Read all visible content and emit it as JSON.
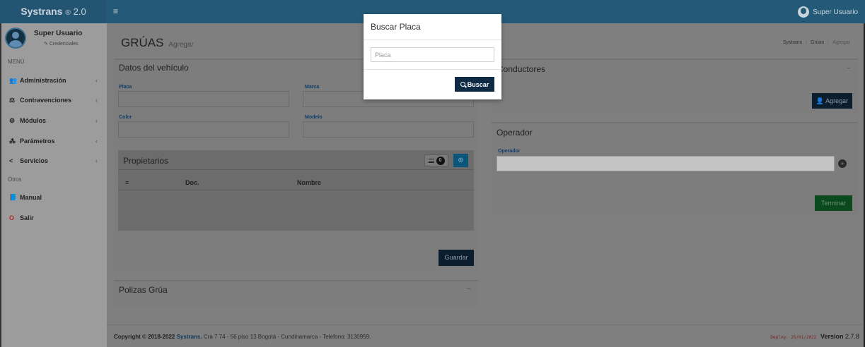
{
  "header": {
    "brand_name": "Systrans",
    "brand_reg": "®",
    "brand_version": "2.0",
    "menu_toggle": "≡",
    "user_name": "Super Usuario"
  },
  "sidebar": {
    "user_name": "Super Usuario",
    "credentials_label": "Credenciales",
    "menu_header": "MENÚ",
    "items": [
      {
        "label": "Administración",
        "icon": "users-icon",
        "glyph": "👥"
      },
      {
        "label": "Contravenciones",
        "icon": "balance-scale-icon",
        "glyph": "⚖"
      },
      {
        "label": "Módulos",
        "icon": "modules-icon",
        "glyph": "⚙"
      },
      {
        "label": "Parámetros",
        "icon": "sitemap-icon",
        "glyph": "⁂"
      },
      {
        "label": "Servicios",
        "icon": "share-icon",
        "glyph": "<"
      }
    ],
    "other_header": "Otros",
    "others": [
      {
        "label": "Manual",
        "icon": "book-icon",
        "glyph": "📘"
      },
      {
        "label": "Salir",
        "icon": "power-icon",
        "glyph": "O"
      }
    ]
  },
  "page": {
    "title": "GRÚAS",
    "subtitle": "Agregar",
    "breadcrumb": [
      "Systrans",
      "Grúas",
      "Agregar"
    ]
  },
  "vehicle": {
    "title": "Datos del vehículo",
    "placa_label": "Placa",
    "marca_label": "Marca",
    "color_label": "Color",
    "modelo_label": "Modelo",
    "placa_value": "",
    "marca_value": "",
    "color_value": "",
    "modelo_value": "",
    "propietarios_title": "Propietarios",
    "propietarios_count": "0",
    "table_headers": [
      "≡",
      "Doc.",
      "Nombre"
    ],
    "save_label": "Guardar"
  },
  "polizas": {
    "title": "Polizas Grúa",
    "collapse": "−"
  },
  "conductores": {
    "title": "Conductores",
    "collapse": "−",
    "add_label": "Agregar"
  },
  "operador": {
    "title": "Operador",
    "field_label": "Operador",
    "field_value": "",
    "finish_label": "Terminar"
  },
  "footer": {
    "copyright": "Copyright © 2018-2022",
    "brand": "Systrans.",
    "address": "Cra 7 74 - 56 piso 13 Bogotá - Cundinamarca - Telefono: 3130959.",
    "deploy": "Deploy: 25/01/2022",
    "version_label": "Version",
    "version": "2.7.8"
  },
  "modal": {
    "title": "Buscar Placa",
    "input_placeholder": "Placa",
    "input_value": "",
    "search_label": "Buscar"
  }
}
